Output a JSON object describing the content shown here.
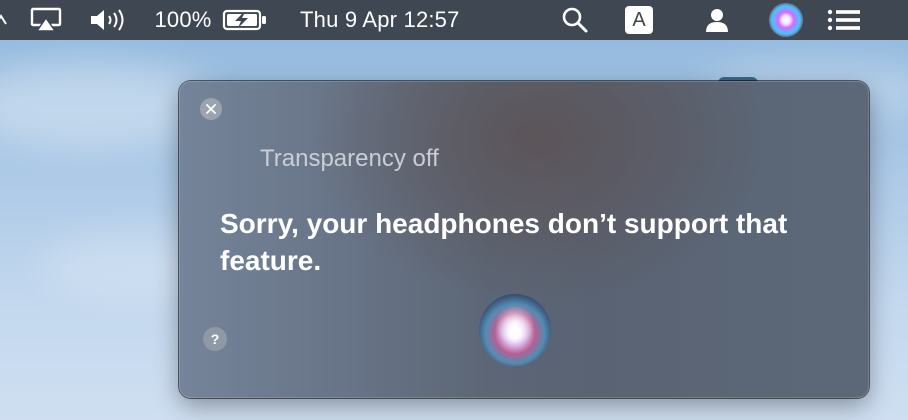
{
  "menubar": {
    "battery_percent": "100%",
    "datetime": "Thu 9 Apr  12:57",
    "input_source": "A",
    "icons": {
      "airplay": "airplay-icon",
      "volume": "volume-icon",
      "battery": "battery-charging-icon",
      "spotlight": "search-icon",
      "user": "user-icon",
      "siri": "siri-icon",
      "notifications": "list-icon"
    }
  },
  "siri": {
    "status": "Transparency off",
    "response": "Sorry, your headphones don’t support that feature.",
    "help": "?"
  },
  "colors": {
    "menubar_bg": "#3f4752",
    "panel_text": "#ffffff",
    "subtitle_text": "#c9ced6"
  }
}
